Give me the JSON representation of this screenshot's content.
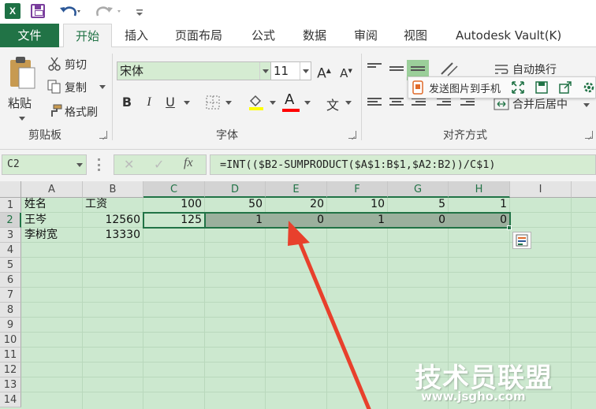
{
  "quick_access": {
    "app_icon": "excel-icon",
    "items": [
      "save-icon",
      "undo-icon",
      "redo-icon",
      "customize-icon"
    ]
  },
  "tabs": [
    {
      "label": "文件"
    },
    {
      "label": "开始"
    },
    {
      "label": "插入"
    },
    {
      "label": "页面布局"
    },
    {
      "label": "公式"
    },
    {
      "label": "数据"
    },
    {
      "label": "审阅"
    },
    {
      "label": "视图"
    },
    {
      "label": "Autodesk Vault(K)"
    }
  ],
  "ribbon": {
    "clipboard": {
      "paste_label": "粘贴",
      "cut_label": "剪切",
      "copy_label": "复制",
      "format_painter_label": "格式刷",
      "group_label": "剪贴板"
    },
    "font": {
      "font_name": "宋体",
      "font_size": "11",
      "group_label": "字体",
      "bold": "B",
      "italic": "I",
      "underline": "U",
      "increase": "A",
      "decrease": "A",
      "color_letter": "A",
      "phonetic": "文"
    },
    "alignment": {
      "wrap_text_label": "自动换行",
      "merge_center_label": "合并后居中",
      "group_label": "对齐方式"
    },
    "floating_toolbar": {
      "send_label": "发送图片到手机"
    }
  },
  "formula_bar": {
    "name_box": "C2",
    "fx": "fx",
    "formula": "=INT(($B2-SUMPRODUCT($A$1:B$1,$A2:B2))/C$1)"
  },
  "sheet": {
    "columns": [
      "A",
      "B",
      "C",
      "D",
      "E",
      "F",
      "G",
      "H",
      "I"
    ],
    "rows": [
      "1",
      "2",
      "3",
      "4",
      "5",
      "6",
      "7",
      "8",
      "9",
      "10",
      "11",
      "12",
      "13",
      "14"
    ],
    "cells": {
      "A1": "姓名",
      "B1": "工资",
      "C1": "100",
      "D1": "50",
      "E1": "20",
      "F1": "10",
      "G1": "5",
      "H1": "1",
      "A2": "王岑",
      "B2": "12560",
      "C2": "125",
      "D2": "1",
      "E2": "0",
      "F2": "1",
      "G2": "0",
      "H2": "0",
      "A3": "李树宽",
      "B3": "13330"
    },
    "selection": "C2:H2",
    "accent_color": "#217346",
    "grid_background": "#cce8cf"
  },
  "watermark": {
    "brand": "技术员联盟",
    "url": "www.jsgho.com"
  }
}
